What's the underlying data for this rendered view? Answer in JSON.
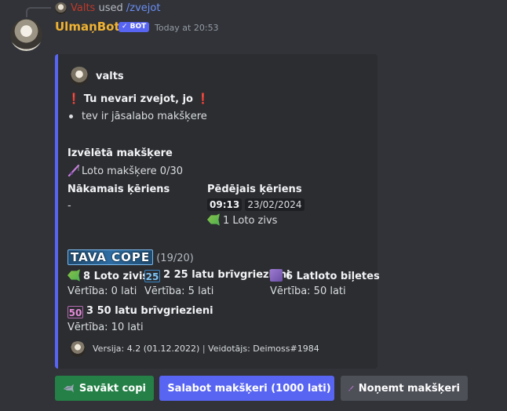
{
  "reply": {
    "user": "Valts",
    "used": "used",
    "command": "/zvejot"
  },
  "message": {
    "username": "UlmaņBots",
    "bot_badge": "✓ BOT",
    "timestamp": "Today at 20:53"
  },
  "embed": {
    "accent_color": "#5865f2",
    "author": "valts",
    "title_left_excl": "❗",
    "title": "Tu nevari zvejot, jo",
    "title_right_excl": "❗",
    "bullet": "tev ir jāsalabo makšķere",
    "selected_rod": {
      "name": "Izvēlētā makšķere",
      "value": "Loto makšķere 0/30",
      "icon": "fishing-rod-icon"
    },
    "next_catch": {
      "name": "Nākamais ķēriens",
      "value": "-"
    },
    "last_catch": {
      "name": "Pēdējais ķēriens",
      "time": "09:13",
      "date": "23/02/2024",
      "item": "1 Loto zivs",
      "icon": "fish-icon"
    },
    "bag": {
      "banner": "TAVA COPE",
      "count": "(19/20)",
      "items": [
        {
          "icon": "fish-icon",
          "label": "8 Loto zivis",
          "value": "Vērtība: 0 lati"
        },
        {
          "icon": "25-badge-icon",
          "badge": "25",
          "label": "2 25 latu brīvgriezieni",
          "value": "Vērtība: 5 lati"
        },
        {
          "icon": "ticket-icon",
          "label": "6 Latloto biļetes",
          "value": "Vērtība: 50 lati"
        },
        {
          "icon": "50-badge-icon",
          "badge": "50",
          "label": "3 50 latu brīvgriezieni",
          "value": "Vērtība: 10 lati"
        }
      ]
    },
    "footer": {
      "version": "Versija: 4.2 (01.12.2022)",
      "separator": "|",
      "author": "Veidotājs: Deimoss#1984"
    }
  },
  "buttons": {
    "collect": "Savākt copi",
    "repair": "Salabot makšķeri (1000 lati)",
    "remove": "Noņemt makšķeri"
  }
}
